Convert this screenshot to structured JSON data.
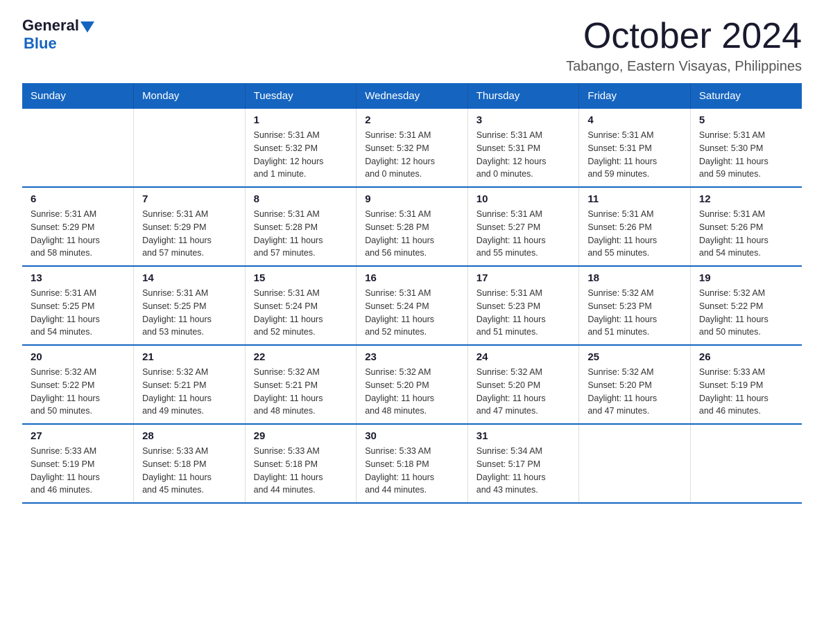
{
  "logo": {
    "general": "General",
    "blue": "Blue"
  },
  "header": {
    "month": "October 2024",
    "location": "Tabango, Eastern Visayas, Philippines"
  },
  "weekdays": [
    "Sunday",
    "Monday",
    "Tuesday",
    "Wednesday",
    "Thursday",
    "Friday",
    "Saturday"
  ],
  "weeks": [
    [
      {
        "day": "",
        "info": ""
      },
      {
        "day": "",
        "info": ""
      },
      {
        "day": "1",
        "info": "Sunrise: 5:31 AM\nSunset: 5:32 PM\nDaylight: 12 hours\nand 1 minute."
      },
      {
        "day": "2",
        "info": "Sunrise: 5:31 AM\nSunset: 5:32 PM\nDaylight: 12 hours\nand 0 minutes."
      },
      {
        "day": "3",
        "info": "Sunrise: 5:31 AM\nSunset: 5:31 PM\nDaylight: 12 hours\nand 0 minutes."
      },
      {
        "day": "4",
        "info": "Sunrise: 5:31 AM\nSunset: 5:31 PM\nDaylight: 11 hours\nand 59 minutes."
      },
      {
        "day": "5",
        "info": "Sunrise: 5:31 AM\nSunset: 5:30 PM\nDaylight: 11 hours\nand 59 minutes."
      }
    ],
    [
      {
        "day": "6",
        "info": "Sunrise: 5:31 AM\nSunset: 5:29 PM\nDaylight: 11 hours\nand 58 minutes."
      },
      {
        "day": "7",
        "info": "Sunrise: 5:31 AM\nSunset: 5:29 PM\nDaylight: 11 hours\nand 57 minutes."
      },
      {
        "day": "8",
        "info": "Sunrise: 5:31 AM\nSunset: 5:28 PM\nDaylight: 11 hours\nand 57 minutes."
      },
      {
        "day": "9",
        "info": "Sunrise: 5:31 AM\nSunset: 5:28 PM\nDaylight: 11 hours\nand 56 minutes."
      },
      {
        "day": "10",
        "info": "Sunrise: 5:31 AM\nSunset: 5:27 PM\nDaylight: 11 hours\nand 55 minutes."
      },
      {
        "day": "11",
        "info": "Sunrise: 5:31 AM\nSunset: 5:26 PM\nDaylight: 11 hours\nand 55 minutes."
      },
      {
        "day": "12",
        "info": "Sunrise: 5:31 AM\nSunset: 5:26 PM\nDaylight: 11 hours\nand 54 minutes."
      }
    ],
    [
      {
        "day": "13",
        "info": "Sunrise: 5:31 AM\nSunset: 5:25 PM\nDaylight: 11 hours\nand 54 minutes."
      },
      {
        "day": "14",
        "info": "Sunrise: 5:31 AM\nSunset: 5:25 PM\nDaylight: 11 hours\nand 53 minutes."
      },
      {
        "day": "15",
        "info": "Sunrise: 5:31 AM\nSunset: 5:24 PM\nDaylight: 11 hours\nand 52 minutes."
      },
      {
        "day": "16",
        "info": "Sunrise: 5:31 AM\nSunset: 5:24 PM\nDaylight: 11 hours\nand 52 minutes."
      },
      {
        "day": "17",
        "info": "Sunrise: 5:31 AM\nSunset: 5:23 PM\nDaylight: 11 hours\nand 51 minutes."
      },
      {
        "day": "18",
        "info": "Sunrise: 5:32 AM\nSunset: 5:23 PM\nDaylight: 11 hours\nand 51 minutes."
      },
      {
        "day": "19",
        "info": "Sunrise: 5:32 AM\nSunset: 5:22 PM\nDaylight: 11 hours\nand 50 minutes."
      }
    ],
    [
      {
        "day": "20",
        "info": "Sunrise: 5:32 AM\nSunset: 5:22 PM\nDaylight: 11 hours\nand 50 minutes."
      },
      {
        "day": "21",
        "info": "Sunrise: 5:32 AM\nSunset: 5:21 PM\nDaylight: 11 hours\nand 49 minutes."
      },
      {
        "day": "22",
        "info": "Sunrise: 5:32 AM\nSunset: 5:21 PM\nDaylight: 11 hours\nand 48 minutes."
      },
      {
        "day": "23",
        "info": "Sunrise: 5:32 AM\nSunset: 5:20 PM\nDaylight: 11 hours\nand 48 minutes."
      },
      {
        "day": "24",
        "info": "Sunrise: 5:32 AM\nSunset: 5:20 PM\nDaylight: 11 hours\nand 47 minutes."
      },
      {
        "day": "25",
        "info": "Sunrise: 5:32 AM\nSunset: 5:20 PM\nDaylight: 11 hours\nand 47 minutes."
      },
      {
        "day": "26",
        "info": "Sunrise: 5:33 AM\nSunset: 5:19 PM\nDaylight: 11 hours\nand 46 minutes."
      }
    ],
    [
      {
        "day": "27",
        "info": "Sunrise: 5:33 AM\nSunset: 5:19 PM\nDaylight: 11 hours\nand 46 minutes."
      },
      {
        "day": "28",
        "info": "Sunrise: 5:33 AM\nSunset: 5:18 PM\nDaylight: 11 hours\nand 45 minutes."
      },
      {
        "day": "29",
        "info": "Sunrise: 5:33 AM\nSunset: 5:18 PM\nDaylight: 11 hours\nand 44 minutes."
      },
      {
        "day": "30",
        "info": "Sunrise: 5:33 AM\nSunset: 5:18 PM\nDaylight: 11 hours\nand 44 minutes."
      },
      {
        "day": "31",
        "info": "Sunrise: 5:34 AM\nSunset: 5:17 PM\nDaylight: 11 hours\nand 43 minutes."
      },
      {
        "day": "",
        "info": ""
      },
      {
        "day": "",
        "info": ""
      }
    ]
  ]
}
